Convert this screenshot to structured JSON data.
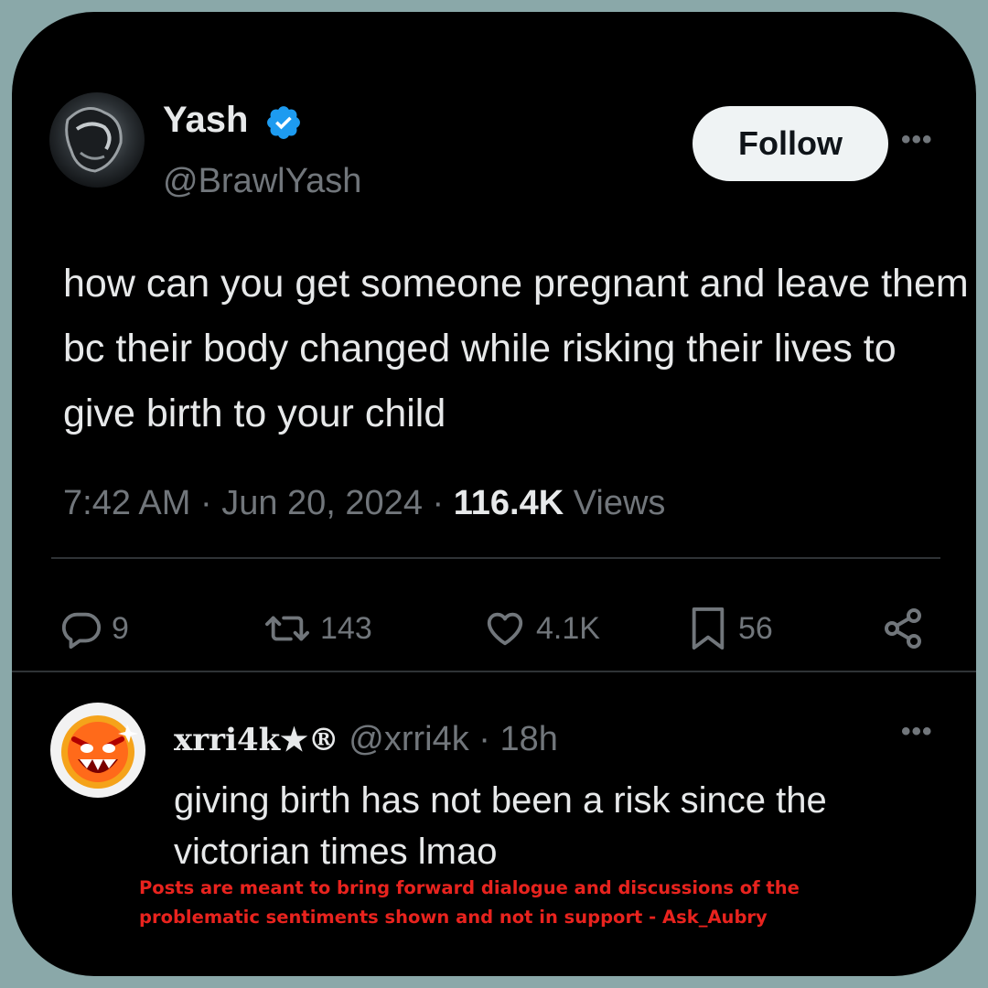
{
  "tweet": {
    "author": {
      "name": "Yash",
      "handle": "@BrawlYash",
      "verified": true
    },
    "follow_label": "Follow",
    "more_label": "•••",
    "text": "how can you get someone pregnant and leave them bc their body changed while risking their lives to give birth to your child",
    "time": "7:42 AM",
    "separator": " · ",
    "date": "Jun 20, 2024",
    "views_count": "116.4K",
    "views_label": " Views",
    "actions": {
      "replies": "9",
      "reposts": "143",
      "likes": "4.1K",
      "bookmarks": "56"
    }
  },
  "reply": {
    "author": {
      "name": "xrri4k★®",
      "handle": "@xrri4k",
      "age": "18h"
    },
    "separator": " · ",
    "more_label": "•••",
    "text": "giving birth has not been a risk since the victorian times lmao"
  },
  "disclaimer": "Posts are meant to bring forward dialogue and discussions of the problematic sentiments shown and not in support - Ask_Aubry",
  "colors": {
    "page_bg": "#8aa8a9",
    "card_bg": "#000000",
    "text_primary": "#e7e9ea",
    "text_secondary": "#71767b",
    "verified_badge": "#1d9bf0",
    "disclaimer": "#e8231e"
  },
  "icons": [
    "verified-badge-icon",
    "reply-icon",
    "repost-icon",
    "like-icon",
    "bookmark-icon",
    "share-icon",
    "more-icon"
  ]
}
